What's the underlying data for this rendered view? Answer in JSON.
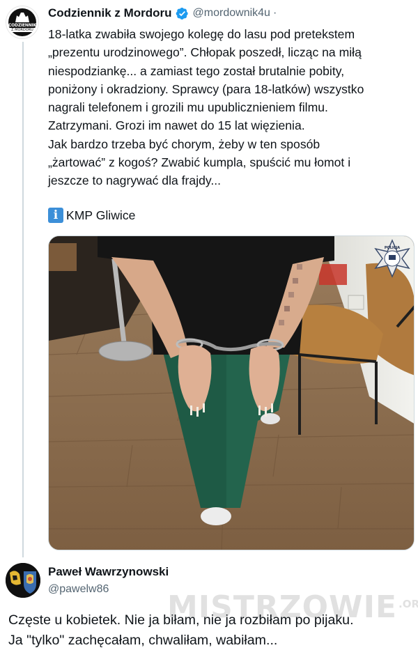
{
  "tweet": {
    "author_name": "Codziennik z Mordoru",
    "author_handle": "@mordownik4u",
    "separator": "·",
    "avatar_text_line1": "CODZIENNIK",
    "avatar_text_line2": "Z MORDORU",
    "text_lines": [
      "18-latka zwabiła swojego kolegę do lasu pod pretekstem",
      "„prezentu urodzinowego”. Chłopak poszedł, licząc na miłą",
      "niespodziankę... a zamiast tego został brutalnie pobity,",
      "poniżony i okradziony. Sprawcy (para 18-latków) wszystko",
      "nagrali telefonem i grozili mu upublicznieniem filmu.",
      "Zatrzymani. Grozi im nawet do 15 lat więzienia.",
      "Jak bardzo trzeba być chorym, żeby w ten sposób",
      "„żartować” z kogoś? Zwabić kumpla, spuścić mu łomot i",
      "jeszcze to nagrywać dla frajdy..."
    ],
    "source_icon": "information-icon",
    "source_icon_glyph": "i",
    "source_label": "KMP Gliwice",
    "media_badge_label": "POLICJA"
  },
  "reply": {
    "author_name": "Paweł Wawrzynowski",
    "author_handle": "@pawelw86",
    "text_lines": [
      "Częste u kobietek. Nie ja biłam, nie ja rozbiłam po pijaku.",
      "Ja \"tylko\" zachęcałam, chwaliłam, wabiłam..."
    ]
  },
  "watermark": {
    "main": "MISTRZOWIE",
    "suffix": ".ORG"
  },
  "colors": {
    "verified": "#1d9bf0",
    "text_primary": "#0f1419",
    "text_secondary": "#536471",
    "thread_line": "#cfd9de",
    "info_icon": "#3c8fd8"
  }
}
